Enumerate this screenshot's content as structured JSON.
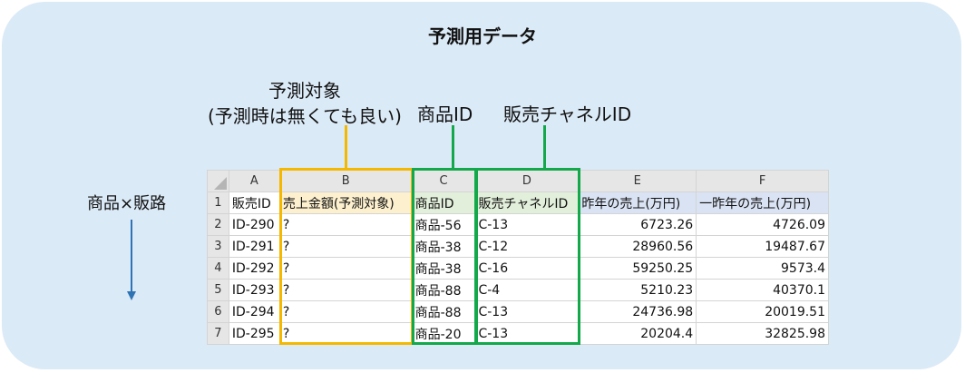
{
  "title": "予測用データ",
  "labels": {
    "target_line1": "予測対象",
    "target_line2": "(予測時は無くても良い)",
    "product_id": "商品ID",
    "channel_id": "販売チャネルID",
    "axis": "商品×販路"
  },
  "colors": {
    "panel": "#dbeaf7",
    "target_box": "#f5b800",
    "key_box": "#13a84a",
    "arrow": "#2e74b5"
  },
  "sheet": {
    "columns": [
      "A",
      "B",
      "C",
      "D",
      "E",
      "F"
    ],
    "headers": [
      "販売ID",
      "売上金額(予測対象)",
      "商品ID",
      "販売チャネルID",
      "昨年の売上(万円)",
      "一昨年の売上(万円)"
    ],
    "rows": [
      {
        "num": "2",
        "cells": [
          "ID-290",
          "?",
          "商品-56",
          "C-13",
          "6723.26",
          "4726.09"
        ]
      },
      {
        "num": "3",
        "cells": [
          "ID-291",
          "?",
          "商品-38",
          "C-12",
          "28960.56",
          "19487.67"
        ]
      },
      {
        "num": "4",
        "cells": [
          "ID-292",
          "?",
          "商品-38",
          "C-16",
          "59250.25",
          "9573.4"
        ]
      },
      {
        "num": "5",
        "cells": [
          "ID-293",
          "?",
          "商品-88",
          "C-4",
          "5210.23",
          "40370.1"
        ]
      },
      {
        "num": "6",
        "cells": [
          "ID-294",
          "?",
          "商品-88",
          "C-13",
          "24736.98",
          "20019.51"
        ]
      },
      {
        "num": "7",
        "cells": [
          "ID-295",
          "?",
          "商品-20",
          "C-13",
          "20204.4",
          "32825.98"
        ]
      }
    ]
  }
}
